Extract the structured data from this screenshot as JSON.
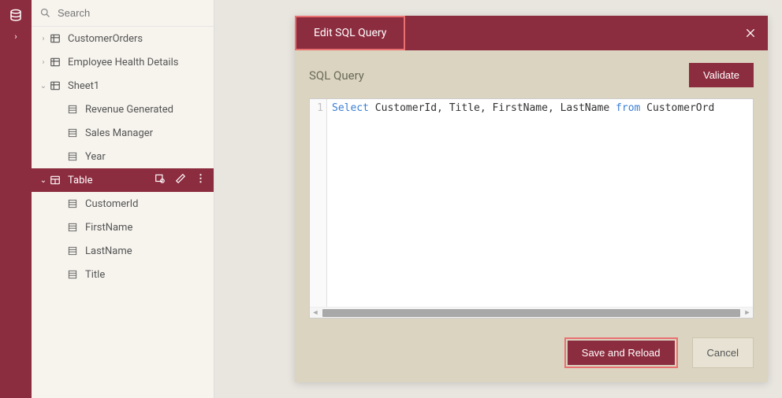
{
  "search": {
    "placeholder": "Search"
  },
  "tree": {
    "items": [
      {
        "label": "CustomerOrders",
        "kind": "table",
        "caret": "right",
        "level": 1
      },
      {
        "label": "Employee Health Details",
        "kind": "table",
        "caret": "right",
        "level": 1
      },
      {
        "label": "Sheet1",
        "kind": "table",
        "caret": "down",
        "level": 1
      },
      {
        "label": "Revenue Generated",
        "kind": "column",
        "level": 2
      },
      {
        "label": "Sales Manager",
        "kind": "column",
        "level": 2
      },
      {
        "label": "Year",
        "kind": "column",
        "level": 2
      },
      {
        "label": "Table",
        "kind": "query",
        "caret": "down",
        "level": 1,
        "active": true
      },
      {
        "label": "CustomerId",
        "kind": "column",
        "level": 2
      },
      {
        "label": "FirstName",
        "kind": "column",
        "level": 2
      },
      {
        "label": "LastName",
        "kind": "column",
        "level": 2
      },
      {
        "label": "Title",
        "kind": "column",
        "level": 2
      }
    ]
  },
  "modal": {
    "title": "Edit SQL Query",
    "body_label": "SQL Query",
    "validate": "Validate",
    "save": "Save and Reload",
    "cancel": "Cancel",
    "line_no": "1",
    "sql_tokens": [
      "Select",
      " CustomerId, Title, FirstName, LastName ",
      "from",
      " CustomerOrd"
    ]
  }
}
